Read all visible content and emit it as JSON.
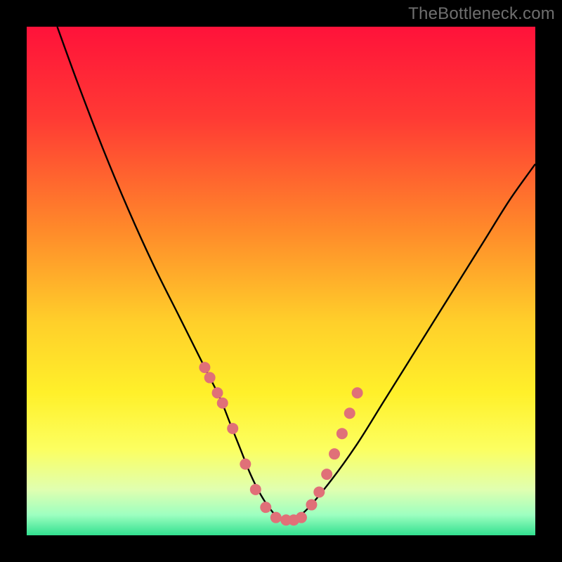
{
  "watermark": "TheBottleneck.com",
  "gradient_stops": [
    {
      "offset": 0.0,
      "color": "#ff123a"
    },
    {
      "offset": 0.18,
      "color": "#ff3a34"
    },
    {
      "offset": 0.4,
      "color": "#ff8a2a"
    },
    {
      "offset": 0.58,
      "color": "#ffcf2a"
    },
    {
      "offset": 0.72,
      "color": "#fff02a"
    },
    {
      "offset": 0.83,
      "color": "#fcff60"
    },
    {
      "offset": 0.91,
      "color": "#e0ffb0"
    },
    {
      "offset": 0.96,
      "color": "#9dffc0"
    },
    {
      "offset": 1.0,
      "color": "#32e090"
    }
  ],
  "chart_data": {
    "type": "line",
    "title": "",
    "xlabel": "",
    "ylabel": "",
    "xlim": [
      0,
      100
    ],
    "ylim": [
      0,
      100
    ],
    "series": [
      {
        "name": "bottleneck-curve",
        "color": "#000000",
        "x": [
          6,
          10,
          15,
          20,
          25,
          30,
          35,
          38,
          40,
          42,
          44,
          46,
          48,
          50,
          52,
          55,
          60,
          65,
          70,
          75,
          80,
          85,
          90,
          95,
          100
        ],
        "y": [
          100,
          89,
          76,
          64,
          53,
          43,
          33,
          27,
          22,
          17,
          12,
          8,
          5,
          3,
          3,
          5,
          11,
          18,
          26,
          34,
          42,
          50,
          58,
          66,
          73
        ]
      }
    ],
    "scatter_points": {
      "name": "hardware-points",
      "color": "#e07078",
      "radius_px": 8,
      "x": [
        35.0,
        36.0,
        37.5,
        38.5,
        40.5,
        43.0,
        45.0,
        47.0,
        49.0,
        51.0,
        52.5,
        54.0,
        56.0,
        57.5,
        59.0,
        60.5,
        62.0,
        63.5,
        65.0
      ],
      "y": [
        33.0,
        31.0,
        28.0,
        26.0,
        21.0,
        14.0,
        9.0,
        5.5,
        3.5,
        3.0,
        3.0,
        3.5,
        6.0,
        8.5,
        12.0,
        16.0,
        20.0,
        24.0,
        28.0
      ]
    }
  }
}
